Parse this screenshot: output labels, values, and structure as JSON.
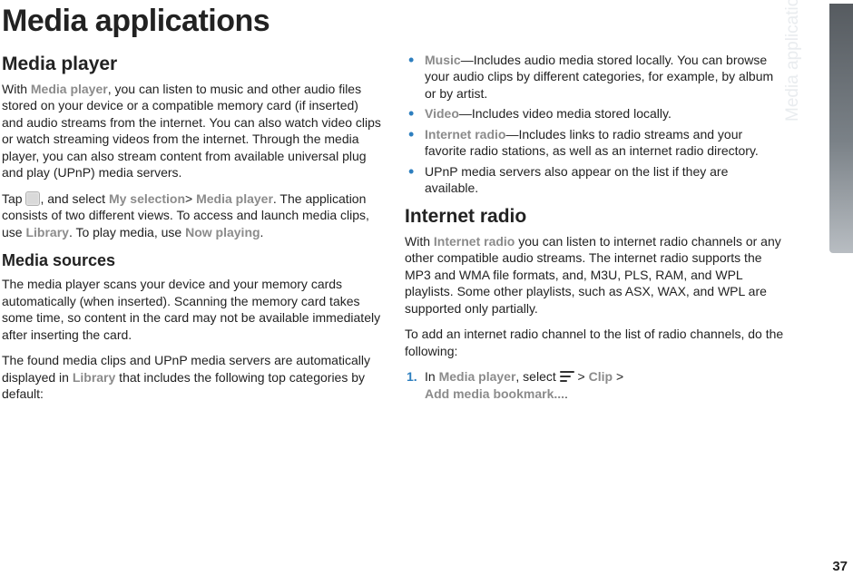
{
  "page_number": "37",
  "side_tab": "Media applications",
  "title": "Media applications",
  "left": {
    "h2_media_player": "Media player",
    "p1_a": "With ",
    "p1_emph": "Media player",
    "p1_b": ", you can listen to music and other audio files stored on your device or a compatible memory card (if inserted) and audio streams from the internet. You can also watch video clips or watch streaming videos from the internet. Through the media player, you can also stream content from available universal plug and play (UPnP) media servers.",
    "p2_a": "Tap ",
    "p2_b": ", and select ",
    "p2_emph1": "My selection",
    "p2_gt": "> ",
    "p2_emph2": "Media player",
    "p2_c": ". The application consists of two different views. To access and launch media clips, use ",
    "p2_emph3": "Library",
    "p2_d": ". To play media, use ",
    "p2_emph4": "Now playing",
    "p2_e": ".",
    "h3_media_sources": "Media sources",
    "p3": "The media player scans your device and your memory cards automatically (when inserted). Scanning the memory card takes some time, so content in the card may not be available immediately after inserting the card.",
    "p4_a": "The found media clips and UPnP media servers are automatically displayed in ",
    "p4_emph": "Library",
    "p4_b": " that includes the following top categories by default:"
  },
  "right": {
    "b1_emph": "Music",
    "b1_text": "—Includes audio media stored locally. You can browse your audio clips by different categories, for example, by album or by artist.",
    "b2_emph": "Video",
    "b2_text": "—Includes video media stored locally.",
    "b3_emph": "Internet radio",
    "b3_text": "—Includes links to radio streams and your favorite radio stations, as well as an internet radio directory.",
    "b4_text": "UPnP media servers also appear on the list if they are available.",
    "h2_internet_radio": "Internet radio",
    "p5_a": "With ",
    "p5_emph": "Internet radio",
    "p5_b": " you can listen to internet radio channels or any other compatible audio streams. The internet radio supports the MP3 and WMA file formats, and, M3U, PLS, RAM, and WPL playlists. Some other playlists, such as ASX, WAX, and WPL are supported only partially.",
    "p6": "To add an internet radio channel to the list of radio channels, do the following:",
    "step1_num": "1.",
    "step1_a": "In ",
    "step1_emph1": "Media player",
    "step1_b": ", select ",
    "step1_gt1": " > ",
    "step1_emph2": "Clip",
    "step1_gt2": " > ",
    "step1_emph3": "Add media bookmark...",
    "step1_c": "."
  }
}
